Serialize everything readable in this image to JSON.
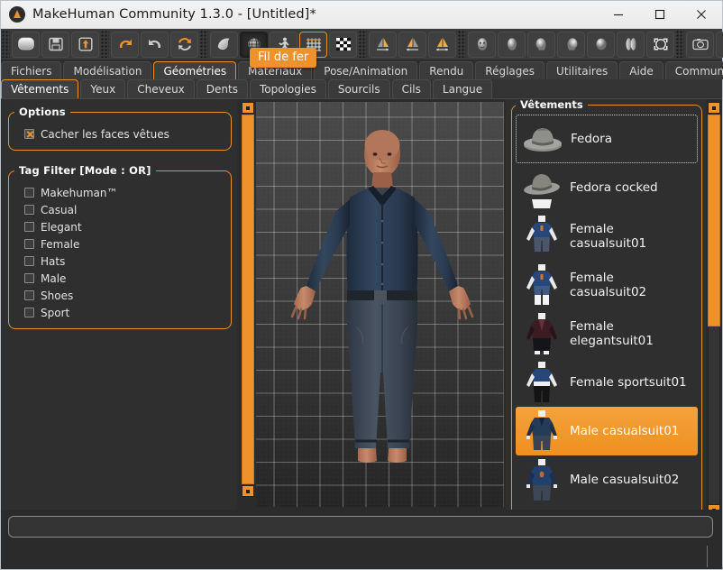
{
  "window": {
    "title": "MakeHuman Community 1.3.0 - [Untitled]*",
    "app_icon": "makehuman-logo-icon",
    "controls": [
      {
        "name": "minimize-button",
        "glyph": "minimize-icon"
      },
      {
        "name": "maximize-button",
        "glyph": "maximize-icon"
      },
      {
        "name": "close-button",
        "glyph": "close-icon"
      }
    ]
  },
  "toolbar": {
    "groups": [
      {
        "buttons": [
          {
            "name": "new-button",
            "icon": "new-mesh-icon",
            "state": "normal"
          },
          {
            "name": "save-button",
            "icon": "floppy-disk-icon",
            "state": "normal"
          },
          {
            "name": "load-button",
            "icon": "load-arrow-icon",
            "state": "normal"
          }
        ]
      },
      {
        "buttons": [
          {
            "name": "undo-button",
            "icon": "undo-arrow-icon",
            "state": "normal"
          },
          {
            "name": "redo-button",
            "icon": "redo-arrow-icon",
            "state": "normal"
          },
          {
            "name": "reset-button",
            "icon": "reset-mesh-icon",
            "state": "normal"
          }
        ]
      },
      {
        "buttons": [
          {
            "name": "smooth-button",
            "icon": "smooth-shading-icon",
            "state": "normal"
          },
          {
            "name": "wireframe-button",
            "icon": "wireframe-globe-icon",
            "state": "active"
          },
          {
            "name": "pose-button",
            "icon": "pose-skeleton-icon",
            "state": "normal"
          },
          {
            "name": "grid-button",
            "icon": "grid-icon",
            "state": "highlighted"
          },
          {
            "name": "background-button",
            "icon": "checkerboard-icon",
            "state": "normal"
          }
        ]
      },
      {
        "buttons": [
          {
            "name": "symmetry-right-button",
            "icon": "symmetry-right-icon",
            "state": "normal"
          },
          {
            "name": "symmetry-left-button",
            "icon": "symmetry-left-icon",
            "state": "normal"
          },
          {
            "name": "symmetry-both-button",
            "icon": "symmetry-both-icon",
            "state": "normal"
          }
        ]
      },
      {
        "buttons": [
          {
            "name": "view-face-button",
            "icon": "face-view-icon",
            "state": "normal"
          },
          {
            "name": "view-front-button",
            "icon": "head-front-icon",
            "state": "normal"
          },
          {
            "name": "view-left-button",
            "icon": "head-left-icon",
            "state": "normal"
          },
          {
            "name": "view-right-button",
            "icon": "head-right-icon",
            "state": "normal"
          },
          {
            "name": "view-top-button",
            "icon": "head-top-icon",
            "state": "normal"
          },
          {
            "name": "view-side-button",
            "icon": "head-split-icon",
            "state": "normal"
          },
          {
            "name": "reset-camera-button",
            "icon": "reset-camera-icon",
            "state": "normal"
          }
        ]
      },
      {
        "buttons": [
          {
            "name": "grab-screen-button",
            "icon": "camera-icon",
            "state": "normal"
          },
          {
            "name": "help-button",
            "icon": "question-mark-icon",
            "state": "normal"
          }
        ]
      }
    ]
  },
  "main_tabs": [
    {
      "label": "Fichiers",
      "active": false
    },
    {
      "label": "Modélisation",
      "active": false
    },
    {
      "label": "Géométries",
      "active": true
    },
    {
      "label": "Matériaux",
      "active": false
    },
    {
      "label": "Pose/Animation",
      "active": false
    },
    {
      "label": "Rendu",
      "active": false
    },
    {
      "label": "Réglages",
      "active": false
    },
    {
      "label": "Utilitaires",
      "active": false
    },
    {
      "label": "Aide",
      "active": false
    },
    {
      "label": "Community",
      "active": false
    }
  ],
  "sub_tabs": [
    {
      "label": "Vêtements",
      "active": true
    },
    {
      "label": "Yeux",
      "active": false
    },
    {
      "label": "Cheveux",
      "active": false
    },
    {
      "label": "Dents",
      "active": false
    },
    {
      "label": "Topologies",
      "active": false
    },
    {
      "label": "Sourcils",
      "active": false
    },
    {
      "label": "Cils",
      "active": false
    },
    {
      "label": "Langue",
      "active": false
    }
  ],
  "tooltip": {
    "text": "Fil de fer",
    "background": "#f0922b"
  },
  "left_panel": {
    "options": {
      "title": "Options",
      "items": [
        {
          "label": "Cacher les faces vêtues",
          "checked": true
        }
      ]
    },
    "tag_filter": {
      "title": "Tag Filter [Mode : OR]",
      "items": [
        {
          "label": "Makehuman™",
          "checked": false
        },
        {
          "label": "Casual",
          "checked": false
        },
        {
          "label": "Elegant",
          "checked": false
        },
        {
          "label": "Female",
          "checked": false
        },
        {
          "label": "Hats",
          "checked": false
        },
        {
          "label": "Male",
          "checked": false
        },
        {
          "label": "Shoes",
          "checked": false
        },
        {
          "label": "Sport",
          "checked": false
        }
      ]
    }
  },
  "right_panel": {
    "title": "Vêtements",
    "items": [
      {
        "label": "Fedora",
        "thumb": "fedora-hat-thumb",
        "selected": false,
        "focused": true
      },
      {
        "label": "Fedora cocked",
        "thumb": "fedora-cocked-thumb",
        "selected": false,
        "focused": false
      },
      {
        "label": "Female casualsuit01",
        "thumb": "female-casualsuit01-thumb",
        "selected": false,
        "focused": false
      },
      {
        "label": "Female casualsuit02",
        "thumb": "female-casualsuit02-thumb",
        "selected": false,
        "focused": false
      },
      {
        "label": "Female elegantsuit01",
        "thumb": "female-elegantsuit01-thumb",
        "selected": false,
        "focused": false
      },
      {
        "label": "Female sportsuit01",
        "thumb": "female-sportsuit01-thumb",
        "selected": false,
        "focused": false
      },
      {
        "label": "Male casualsuit01",
        "thumb": "male-casualsuit01-thumb",
        "selected": true,
        "focused": false
      },
      {
        "label": "Male casualsuit02",
        "thumb": "male-casualsuit02-thumb",
        "selected": false,
        "focused": false
      }
    ]
  },
  "viewport": {
    "model": "human-figure-male-casualsuit01",
    "grid_visible": true,
    "shirt_color": "#2d3f58",
    "jeans_color": "#3c4552",
    "skin_color": "#c08468"
  },
  "statusbar": {
    "text": ""
  },
  "colors": {
    "accent": "#f0922b",
    "panel_bg": "#2f2f2f",
    "window_bg": "#2b2b2b",
    "toolbar_bg": "#3a3a3a"
  }
}
